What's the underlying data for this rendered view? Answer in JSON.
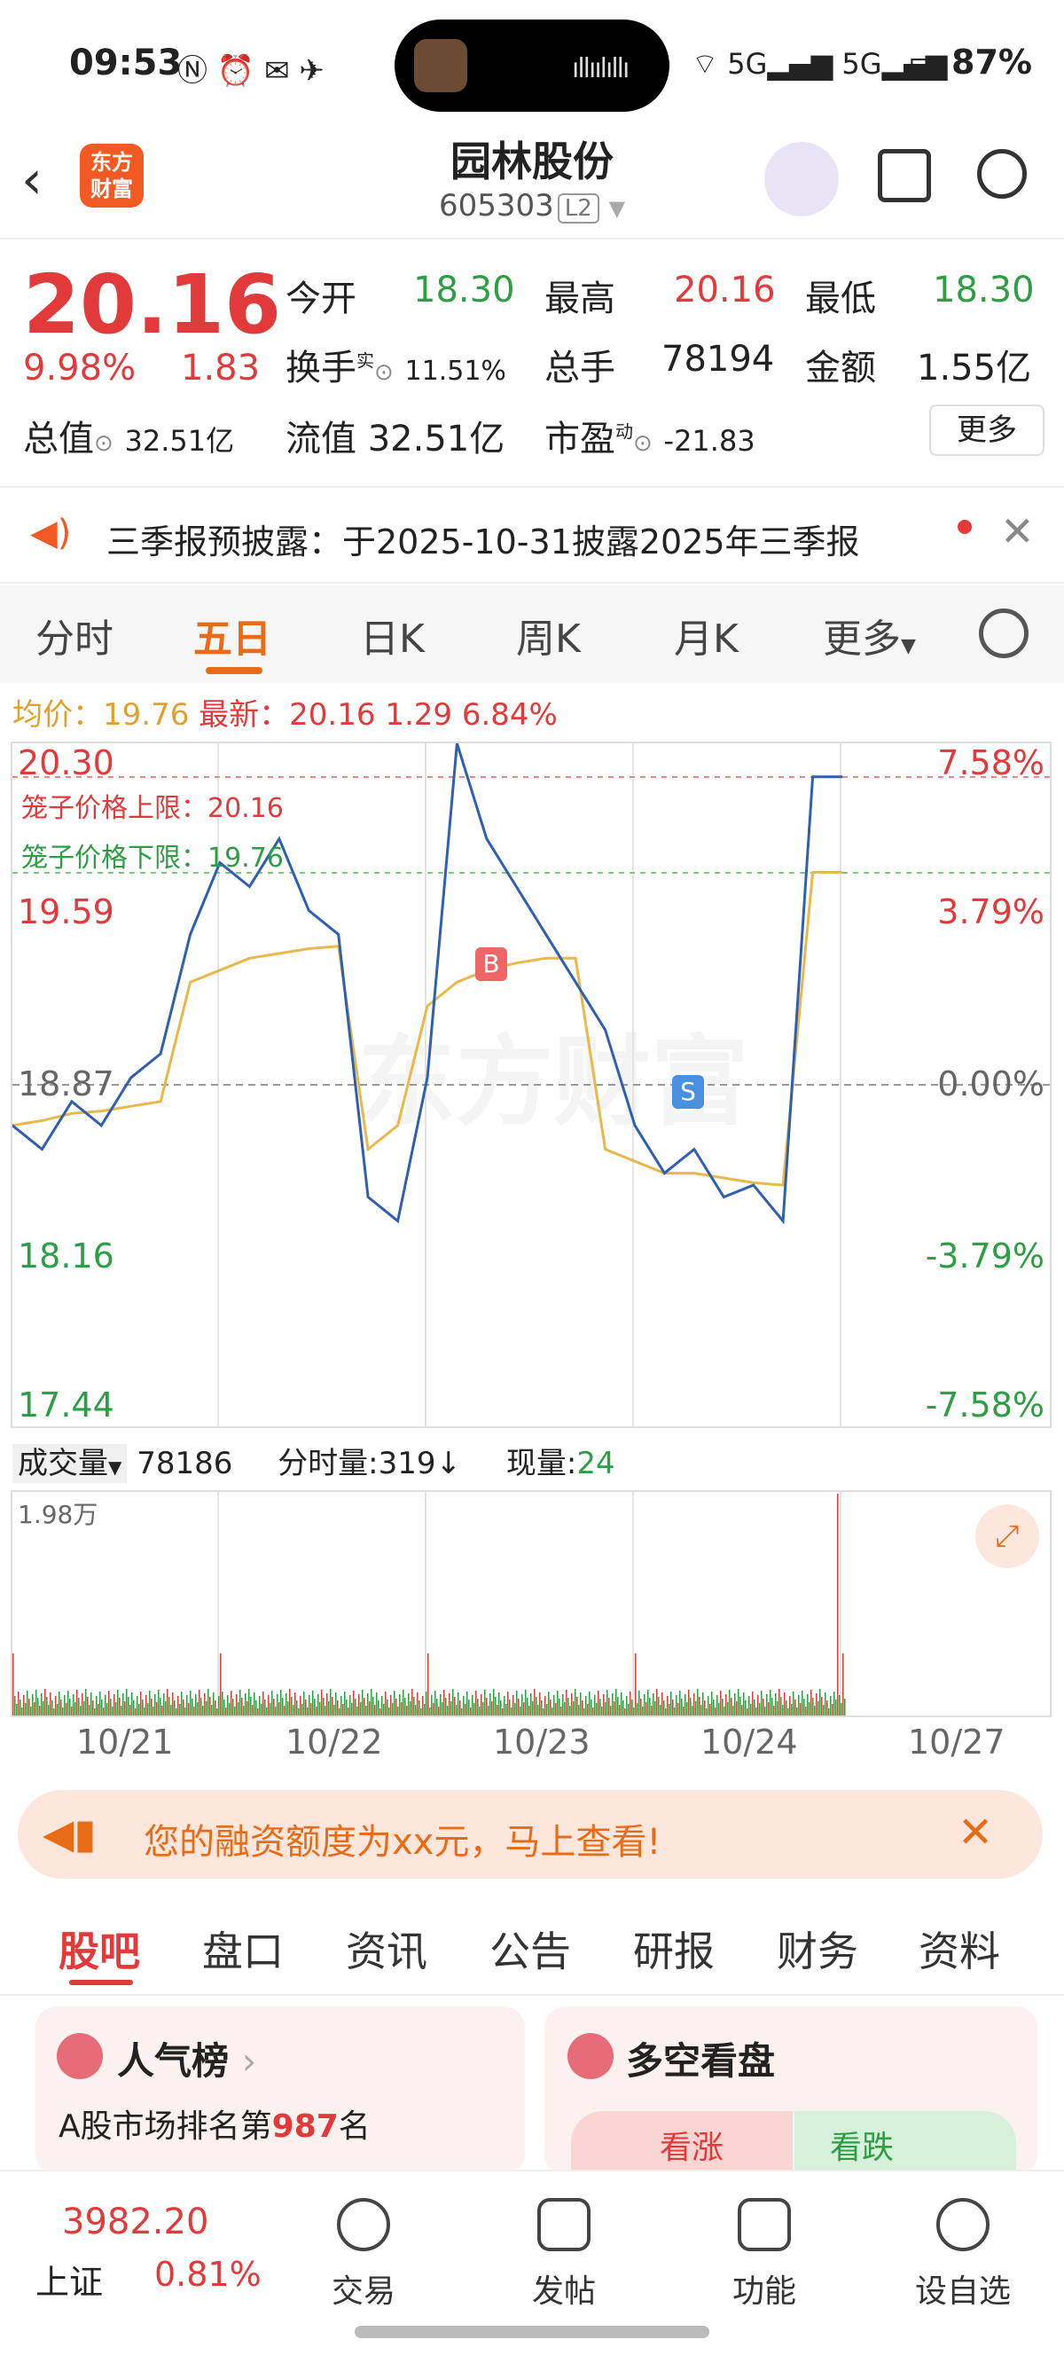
{
  "status": {
    "time": "09:53",
    "net": "5G",
    "battery": "87%"
  },
  "header": {
    "logo": "东方\n财富",
    "title": "园林股份",
    "code": "605303",
    "level": "L2"
  },
  "quote": {
    "price": "20.16",
    "pct": "9.98%",
    "chg": "1.83",
    "open_label": "今开",
    "open": "18.30",
    "high_label": "最高",
    "high": "20.16",
    "low_label": "最低",
    "low": "18.30",
    "turnover_label": "换手",
    "turnover_sup": "实",
    "turnover": "11.51%",
    "hands_label": "总手",
    "hands": "78194",
    "amount_label": "金额",
    "amount": "1.55亿",
    "mktcap_label": "总值",
    "mktcap": "32.51亿",
    "float_label": "流值",
    "float": "32.51亿",
    "pe_label": "市盈",
    "pe_sup": "动",
    "pe": "-21.83",
    "more": "更多"
  },
  "notice": {
    "text": "三季报预披露：于2025-10-31披露2025年三季报"
  },
  "tabs": [
    "分时",
    "五日",
    "日K",
    "周K",
    "月K",
    "更多"
  ],
  "chart_info": {
    "avg_label": "均价：",
    "avg": "19.76",
    "latest_label": "最新：",
    "latest": "20.16",
    "chg": "1.29",
    "pct": "6.84%"
  },
  "chart_labels": {
    "cage_upper": "笼子价格上限：20.16",
    "cage_lower": "笼子价格下限：19.76",
    "left_ticks": [
      "20.30",
      "19.59",
      "18.87",
      "18.16",
      "17.44"
    ],
    "right_ticks": [
      "7.58%",
      "3.79%",
      "0.00%",
      "-3.79%",
      "-7.58%"
    ],
    "buy": "B",
    "sell": "S",
    "watermark": "东方财富"
  },
  "chart_data": {
    "type": "line",
    "ylim": [
      17.44,
      20.3
    ],
    "x": [
      "10/21",
      "10/22",
      "10/23",
      "10/24",
      "10/27"
    ],
    "series": [
      {
        "name": "",
        "values": [
          18.7,
          18.6,
          18.8,
          18.7,
          18.9,
          19.0,
          19.5,
          19.8,
          19.7,
          19.9,
          19.6,
          19.5,
          18.4,
          18.3,
          18.9,
          20.3,
          19.9,
          19.7,
          19.5,
          19.3,
          19.1,
          18.7,
          18.5,
          18.6,
          18.4,
          18.45,
          18.3,
          20.16,
          20.16
        ]
      },
      {
        "name": "",
        "values": [
          18.7,
          18.72,
          18.75,
          18.76,
          18.78,
          18.8,
          19.3,
          19.35,
          19.4,
          19.42,
          19.44,
          19.45,
          18.6,
          18.7,
          19.2,
          19.3,
          19.35,
          19.38,
          19.4,
          19.4,
          18.6,
          18.55,
          18.5,
          18.5,
          18.48,
          18.46,
          18.45,
          19.76,
          19.76
        ]
      }
    ]
  },
  "volume": {
    "label": "成交量",
    "total": "78186",
    "fs_label": "分时量:",
    "fs": "319",
    "fs_arrow": "↓",
    "now_label": "现量:",
    "now": "24",
    "max": "1.98万"
  },
  "promo": {
    "text": "您的融资额度为xx元，马上查看!"
  },
  "bottom_tabs": [
    "股吧",
    "盘口",
    "资讯",
    "公告",
    "研报",
    "财务",
    "资料"
  ],
  "cards": {
    "left_title": "人气榜",
    "left_sub": "A股市场排名第",
    "left_rank": "987",
    "left_unit": "名",
    "right_title": "多空看盘",
    "up": "看涨",
    "down": "看跌"
  },
  "nav": {
    "index": "3982.20",
    "index_name": "上证",
    "index_pct": "0.81%",
    "items": [
      "交易",
      "发帖",
      "功能",
      "设自选"
    ]
  }
}
